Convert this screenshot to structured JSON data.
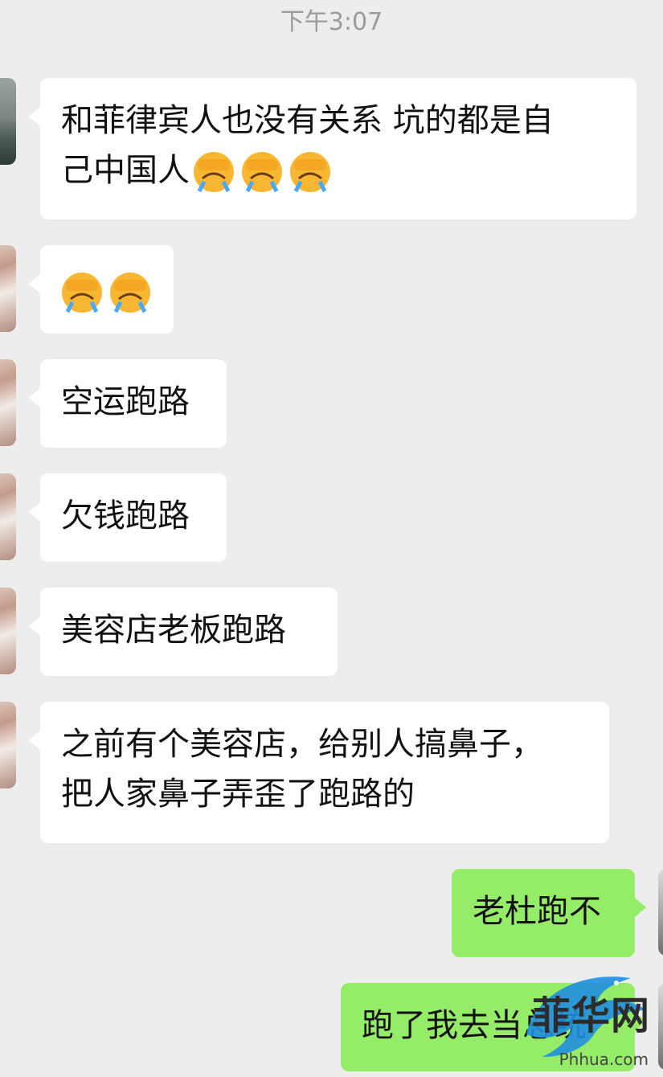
{
  "chat": {
    "timestamp": "下午3:07",
    "messages": [
      {
        "from": "other",
        "lines": [
          "和菲律宾人也没有关系 坑的都是自",
          "己中国人"
        ],
        "emoji_count": 3,
        "emoji": "facepalm-crying-emoji"
      },
      {
        "from": "other",
        "lines": [],
        "emoji_count": 2,
        "emoji": "facepalm-crying-emoji"
      },
      {
        "from": "other",
        "lines": [
          "空运跑路"
        ]
      },
      {
        "from": "other",
        "lines": [
          "欠钱跑路"
        ]
      },
      {
        "from": "other",
        "lines": [
          "美容店老板跑路"
        ]
      },
      {
        "from": "other",
        "lines": [
          "之前有个美容店，给别人搞鼻子，",
          "把人家鼻子弄歪了跑路的"
        ]
      },
      {
        "from": "me",
        "lines": [
          "老杜跑不"
        ]
      },
      {
        "from": "me",
        "lines": [
          "跑了我去当总统"
        ]
      }
    ]
  },
  "colors": {
    "background": "#ededed",
    "incoming_bubble": "#ffffff",
    "outgoing_bubble": "#95ec69",
    "timestamp_text": "#9b9b9b"
  },
  "watermark": {
    "text": "菲华网",
    "domain": "Phhua.com"
  }
}
